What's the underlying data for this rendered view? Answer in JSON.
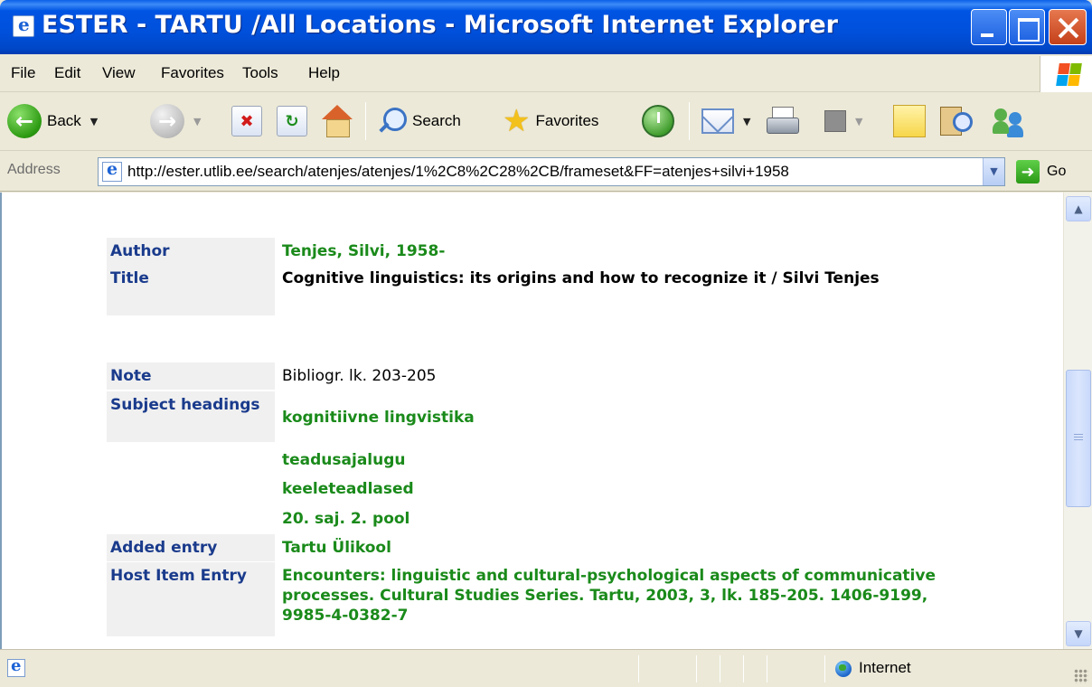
{
  "window": {
    "title": "ESTER - TARTU /All Locations - Microsoft Internet Explorer"
  },
  "menu": [
    "File",
    "Edit",
    "View",
    "Favorites",
    "Tools",
    "Help"
  ],
  "toolbar": {
    "back_label": "Back",
    "search_label": "Search",
    "favorites_label": "Favorites"
  },
  "address": {
    "label": "Address",
    "url": "http://ester.utlib.ee/search/atenjes/atenjes/1%2C8%2C28%2CB/frameset&FF=atenjes+silvi+1958",
    "go_label": "Go"
  },
  "record": {
    "author_label": "Author",
    "author_value": "Tenjes, Silvi, 1958-",
    "title_label": "Title",
    "title_value": "Cognitive linguistics: its origins and how to recognize it / Silvi Tenjes",
    "note_label": "Note",
    "note_value": "Bibliogr. lk. 203-205",
    "subject_label": "Subject headings",
    "subjects": [
      "kognitiivne lingvistika",
      "teadusajalugu",
      "keeleteadlased",
      "20. saj. 2. pool"
    ],
    "added_label": "Added entry",
    "added_value": "Tartu Ülikool",
    "host_label": "Host Item Entry",
    "host_value": "Encounters: linguistic and cultural-psychological aspects of communicative processes. Cultural Studies Series. Tartu, 2003, 3, lk. 185-205. 1406-9199, 9985-4-0382-7"
  },
  "status": {
    "zone": "Internet"
  },
  "colors": {
    "label_blue": "#1a3b8c",
    "link_green": "#1a8a1a",
    "titlebar_blue": "#0054E3"
  },
  "icons": [
    "ie-page-icon",
    "minimize-icon",
    "maximize-icon",
    "close-icon",
    "windows-logo",
    "back-arrow-icon",
    "forward-arrow-icon",
    "stop-icon",
    "refresh-icon",
    "home-icon",
    "search-icon",
    "favorites-star-icon",
    "history-icon",
    "mail-icon",
    "print-icon",
    "edit-icon",
    "notes-icon",
    "research-icon",
    "messenger-icon",
    "go-arrow-icon",
    "internet-globe-icon"
  ]
}
